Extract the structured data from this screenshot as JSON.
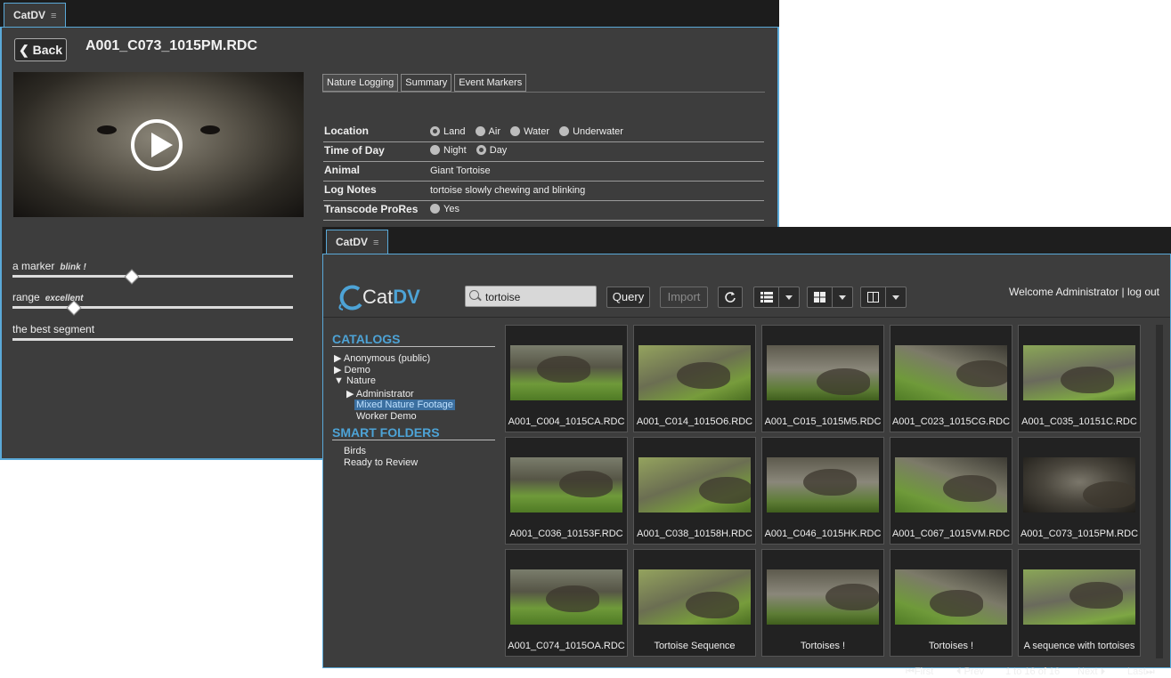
{
  "back_window": {
    "tab_label": "CatDV",
    "back_label": "Back",
    "clip_name": "A001_C073_1015PM.RDC",
    "metadata_tabs": [
      "Nature Logging",
      "Summary",
      "Event Markers"
    ],
    "fields": {
      "location": {
        "label": "Location",
        "options": [
          "Land",
          "Air",
          "Water",
          "Underwater"
        ],
        "selected": "Land"
      },
      "time_of_day": {
        "label": "Time of Day",
        "options": [
          "Night",
          "Day"
        ],
        "selected": "Day"
      },
      "animal": {
        "label": "Animal",
        "value": "Giant Tortoise"
      },
      "log_notes": {
        "label": "Log Notes",
        "value": "tortoise slowly chewing and blinking"
      },
      "transcode": {
        "label": "Transcode ProRes",
        "options": [
          "Yes"
        ],
        "selected": ""
      }
    },
    "markers": [
      {
        "name": "a marker",
        "note": "blink !",
        "position": 0.42
      },
      {
        "name": "range",
        "note": "excellent",
        "position": 0.21
      },
      {
        "name": "the best segment",
        "note": "",
        "position": null
      }
    ]
  },
  "front_window": {
    "tab_label": "CatDV",
    "logo_text": {
      "cat": "Cat",
      "dv": "DV"
    },
    "search": {
      "value": "tortoise"
    },
    "toolbar": {
      "query_label": "Query",
      "import_label": "Import"
    },
    "user": {
      "welcome": "Welcome Administrator",
      "sep": "|",
      "logout": "log out"
    },
    "sidebar": {
      "catalogs_heading": "CATALOGS",
      "catalogs": [
        {
          "label": "Anonymous (public)",
          "arrow": "▶"
        },
        {
          "label": "Demo",
          "arrow": "▶"
        },
        {
          "label": "Nature",
          "arrow": "▼"
        }
      ],
      "nature_children": [
        {
          "label": "Administrator",
          "arrow": "▶"
        },
        {
          "label": "Mixed Nature Footage",
          "selected": true
        },
        {
          "label": "Worker Demo"
        }
      ],
      "smart_heading": "SMART FOLDERS",
      "smart_folders": [
        "Birds",
        "Ready to Review"
      ]
    },
    "clips": [
      "A001_C004_1015CA.RDC",
      "A001_C014_1015O6.RDC",
      "A001_C015_1015M5.RDC",
      "A001_C023_1015CG.RDC",
      "A001_C035_10151C.RDC",
      "A001_C036_10153F.RDC",
      "A001_C038_10158H.RDC",
      "A001_C046_1015HK.RDC",
      "A001_C067_1015VM.RDC",
      "A001_C073_1015PM.RDC",
      "A001_C074_1015OA.RDC",
      "Tortoise Sequence",
      "Tortoises !",
      "Tortoises !",
      "A sequence with tortoises"
    ],
    "pager": {
      "first": "First",
      "prev": "Prev",
      "range": "1 to 16 of 16",
      "next": "Next",
      "last": "Last"
    },
    "colors": {
      "accent": "#4da3d6",
      "panel": "#3d3d3d",
      "grass": "#6f9a3a"
    }
  }
}
